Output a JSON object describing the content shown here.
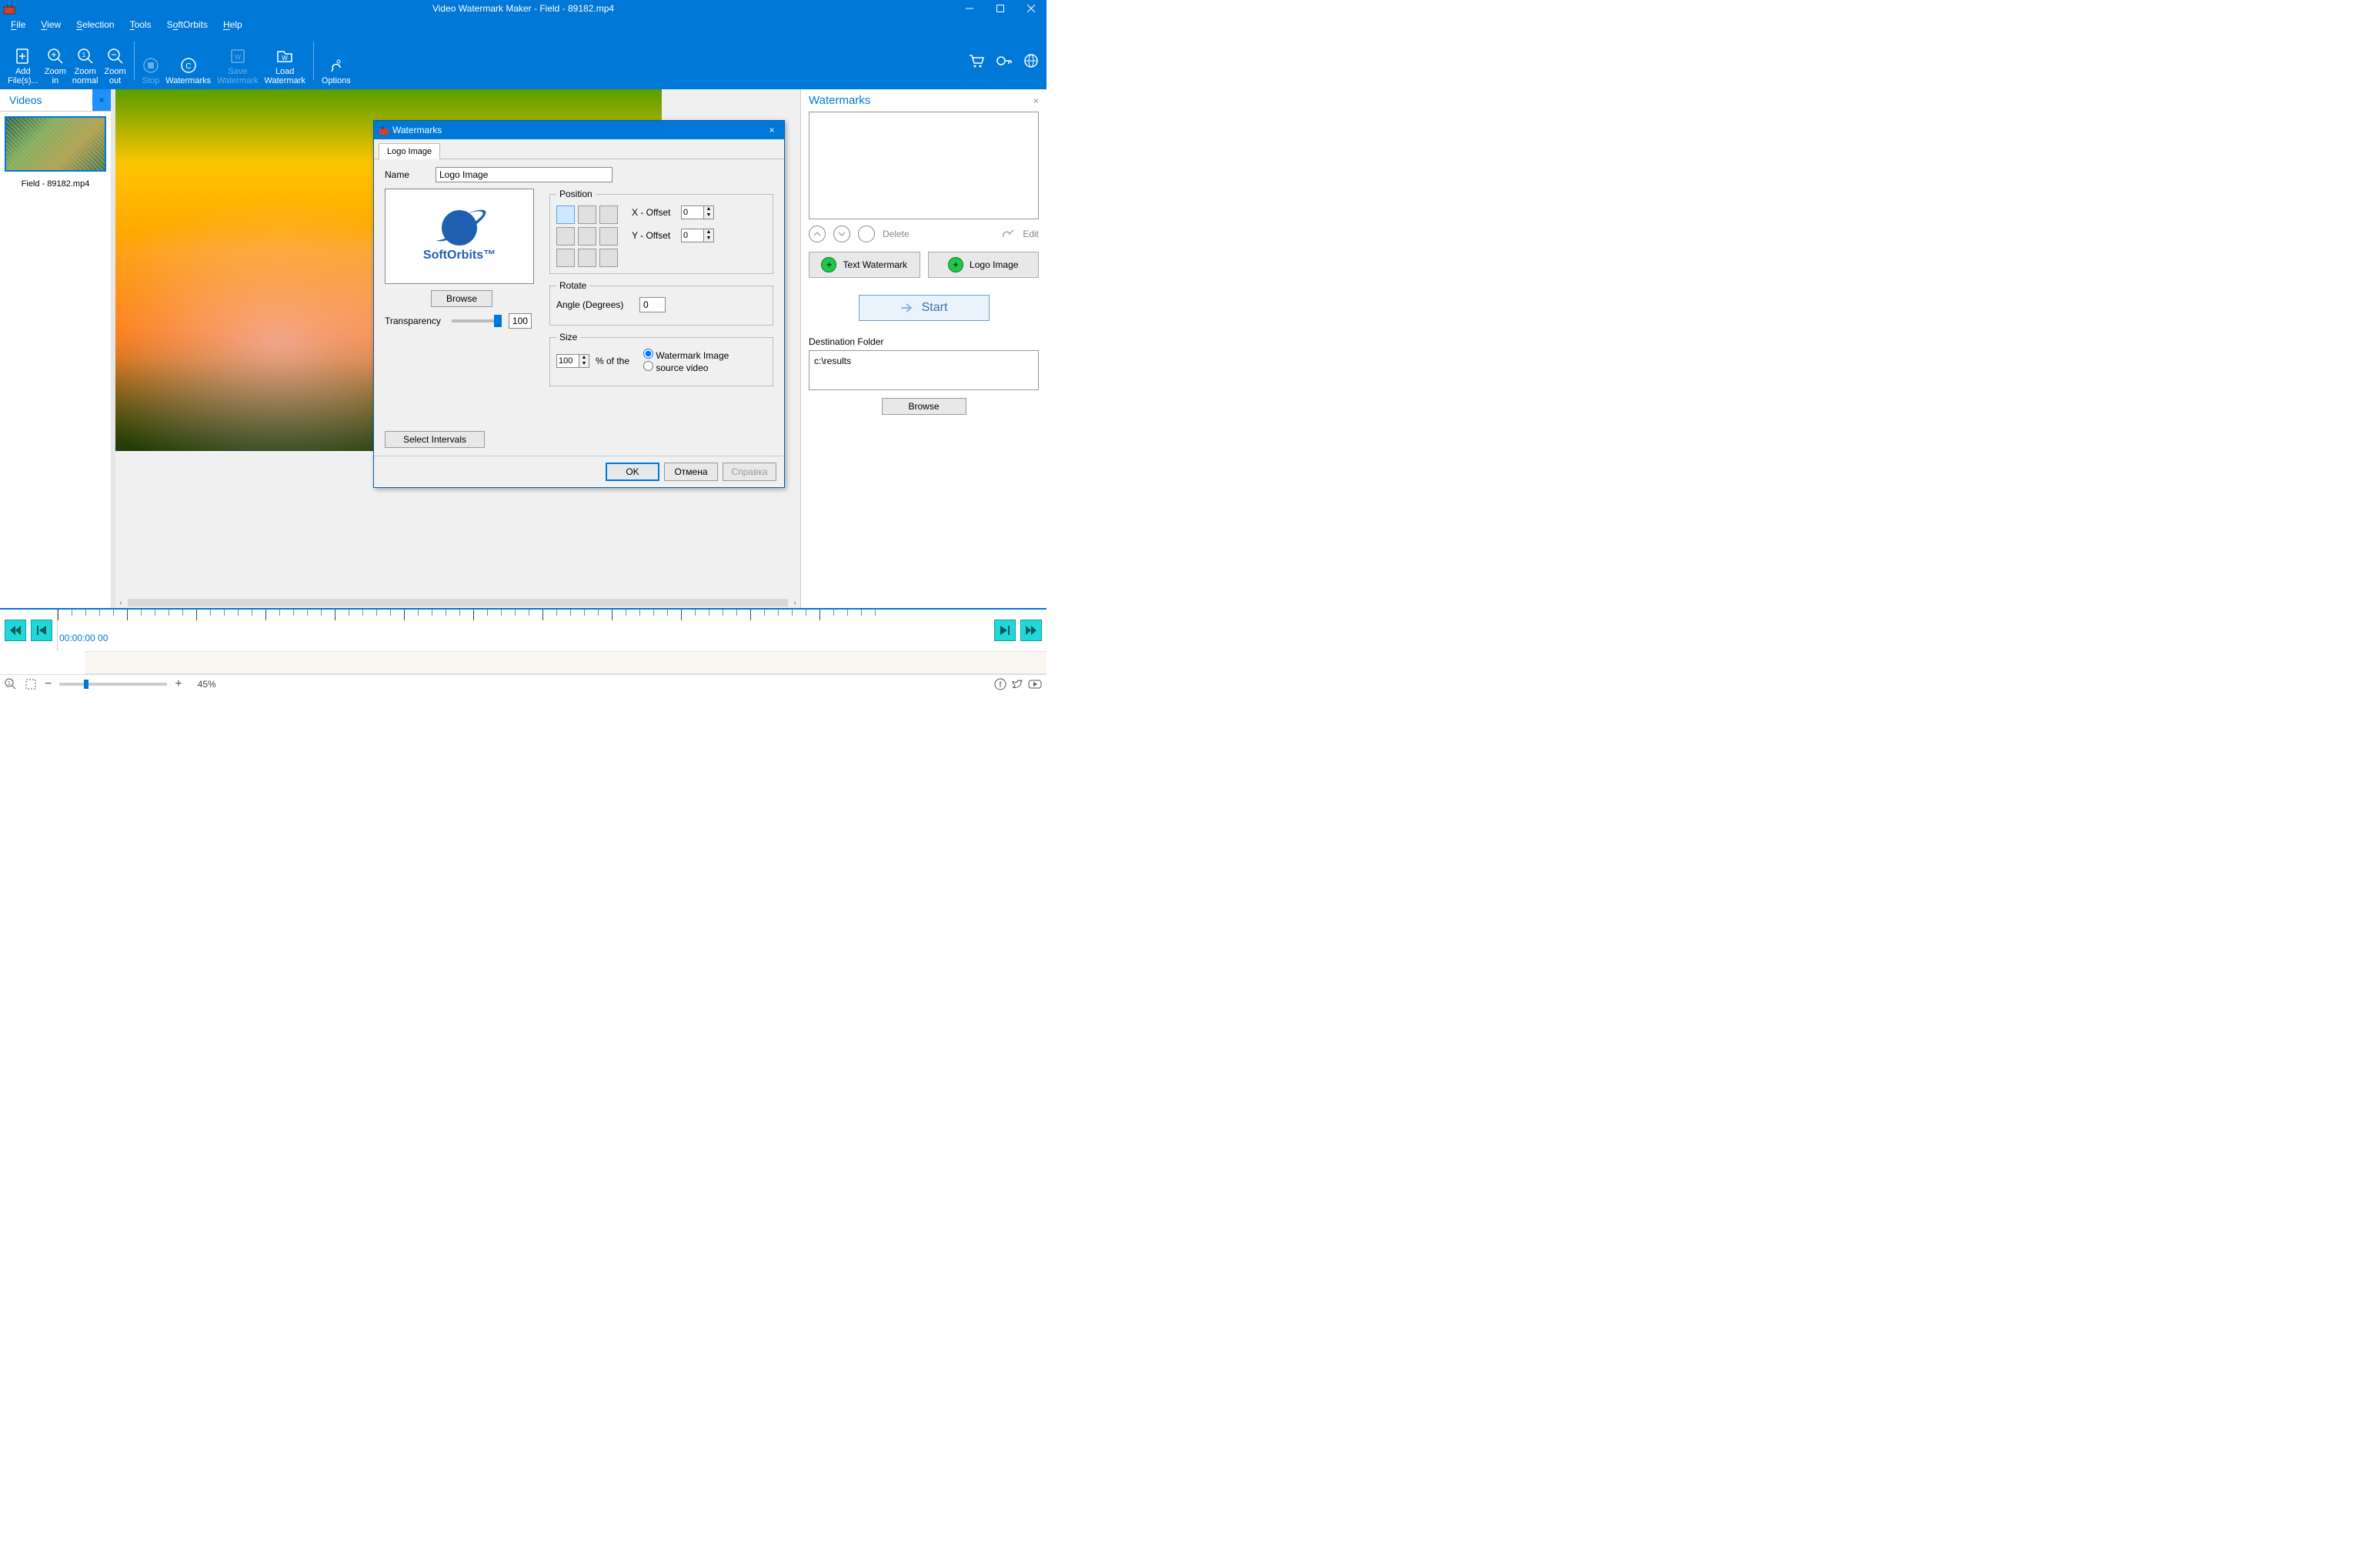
{
  "title": "Video Watermark Maker - Field - 89182.mp4",
  "menu": {
    "file": "File",
    "view": "View",
    "selection": "Selection",
    "tools": "Tools",
    "softorbits": "SoftOrbits",
    "help": "Help"
  },
  "toolbar": {
    "add_files": "Add\nFile(s)...",
    "zoom_in": "Zoom\nin",
    "zoom_normal": "Zoom\nnormal",
    "zoom_out": "Zoom\nout",
    "stop": "Stop",
    "watermarks": "Watermarks",
    "save_wm": "Save\nWatermark",
    "load_wm": "Load\nWatermark",
    "options": "Options"
  },
  "videos_panel": {
    "title": "Videos",
    "item": "Field - 89182.mp4"
  },
  "wm_panel": {
    "title": "Watermarks",
    "delete": "Delete",
    "edit": "Edit",
    "text_wm": "Text Watermark",
    "logo_img": "Logo Image",
    "start": "Start",
    "dest_label": "Destination Folder",
    "dest_value": "c:\\results",
    "browse": "Browse"
  },
  "dialog": {
    "title": "Watermarks",
    "tab": "Logo Image",
    "name_label": "Name",
    "name_value": "Logo Image",
    "preview_text": "SoftOrbits™",
    "browse": "Browse",
    "transparency_label": "Transparency",
    "transparency_value": "100",
    "position_label": "Position",
    "x_offset_label": "X - Offset",
    "x_offset": "0",
    "y_offset_label": "Y - Offset",
    "y_offset": "0",
    "rotate_label": "Rotate",
    "angle_label": "Angle (Degrees)",
    "angle": "0",
    "size_label": "Size",
    "size_value": "100",
    "of_the": "% of the",
    "radio_wm_image": "Watermark Image",
    "radio_source": "source video",
    "select_intervals": "Select Intervals",
    "ok": "OK",
    "cancel": "Отмена",
    "help": "Справка"
  },
  "timeline": {
    "timecode": "00:00:00 00"
  },
  "status": {
    "zoom": "45%"
  }
}
